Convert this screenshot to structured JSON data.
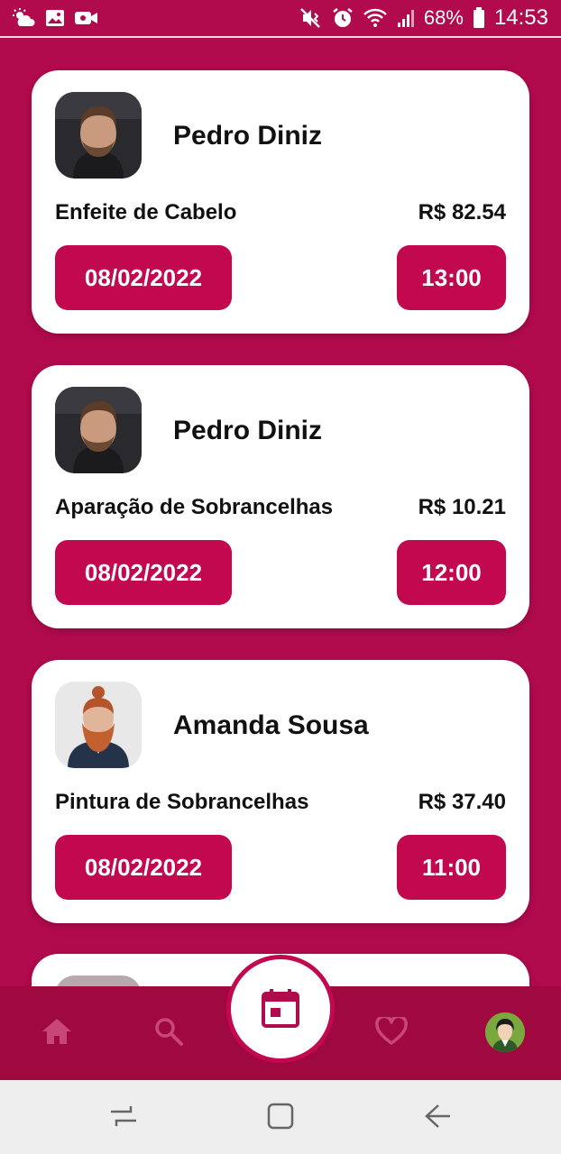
{
  "status_bar": {
    "battery": "68%",
    "time": "14:53"
  },
  "appointments": [
    {
      "name": "Pedro Diniz",
      "service": "Enfeite de Cabelo",
      "price": "R$ 82.54",
      "date": "08/02/2022",
      "time": "13:00"
    },
    {
      "name": "Pedro Diniz",
      "service": "Aparação de Sobrancelhas",
      "price": "R$ 10.21",
      "date": "08/02/2022",
      "time": "12:00"
    },
    {
      "name": "Amanda Sousa",
      "service": "Pintura de Sobrancelhas",
      "price": "R$ 37.40",
      "date": "08/02/2022",
      "time": "11:00"
    }
  ],
  "bottom_nav": {
    "items": [
      "home-icon",
      "search-icon",
      "calendar-icon",
      "heart-icon",
      "profile-avatar"
    ]
  },
  "colors": {
    "background": "#b10a4d",
    "accent": "#c2084f",
    "nav": "#a0093f"
  }
}
